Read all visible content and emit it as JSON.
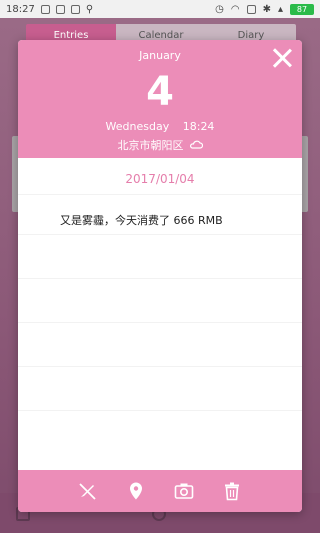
{
  "status_bar": {
    "time": "18:27",
    "battery": "87"
  },
  "background": {
    "tabs": [
      "Entries",
      "Calendar",
      "Diary"
    ]
  },
  "dialog": {
    "month": "January",
    "day": "4",
    "weekday": "Wednesday",
    "time": "18:24",
    "location": "北京市朝阳区",
    "date": "2017/01/04",
    "note": "又是雾霾，今天消费了  666 RMB",
    "weather_icon": "cloud-icon",
    "close_icon": "close-icon",
    "toolbar_icons": [
      "edit-icon",
      "location-pin-icon",
      "camera-icon",
      "trash-icon"
    ]
  },
  "colors": {
    "accent": "#ec8db8",
    "date_text": "#e57eab",
    "status_green": "#2bbb4a"
  }
}
